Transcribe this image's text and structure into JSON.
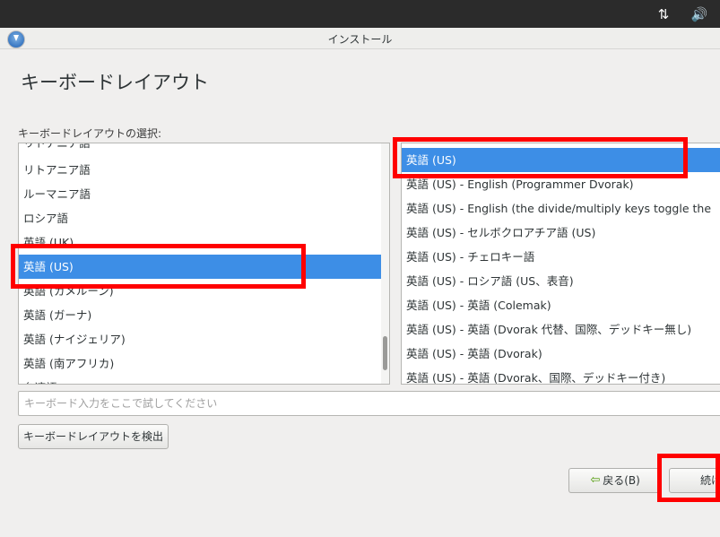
{
  "system_panel": {
    "network_icon": "updown-arrows-icon",
    "volume_icon": "speaker-icon"
  },
  "window": {
    "title": "インストール"
  },
  "page": {
    "title": "キーボードレイアウト",
    "select_label": "キーボードレイアウトの選択:"
  },
  "layouts": [
    {
      "label": "リトアニア語"
    },
    {
      "label": "リトアニア語"
    },
    {
      "label": "ルーマニア語"
    },
    {
      "label": "ロシア語"
    },
    {
      "label": "英語 (UK)"
    },
    {
      "label": "英語 (US)",
      "selected": true
    },
    {
      "label": "英語 (カメルーン)"
    },
    {
      "label": "英語 (ガーナ)"
    },
    {
      "label": "英語 (ナイジェリア)"
    },
    {
      "label": "英語 (南アフリカ)"
    },
    {
      "label": "台湾語"
    }
  ],
  "variants": [
    {
      "label": "英語 (US)",
      "selected": true
    },
    {
      "label": "英語 (US) - English (Programmer Dvorak)"
    },
    {
      "label": "英語 (US) - English (the divide/multiply keys toggle the"
    },
    {
      "label": "英語 (US) - セルボクロアチア語 (US)"
    },
    {
      "label": "英語 (US) - チェロキー語"
    },
    {
      "label": "英語 (US) - ロシア語 (US、表音)"
    },
    {
      "label": "英語 (US) - 英語 (Colemak)"
    },
    {
      "label": "英語 (US) - 英語 (Dvorak 代替、国際、デッドキー無し)"
    },
    {
      "label": "英語 (US) - 英語 (Dvorak)"
    },
    {
      "label": "英語 (US) - 英語 (Dvorak、国際、デッドキー付き)"
    }
  ],
  "test_input": {
    "value": "",
    "placeholder": "キーボード入力をここで試してください"
  },
  "buttons": {
    "detect": "キーボードレイアウトを検出",
    "back": "戻る(B)",
    "continue": "続け"
  },
  "colors": {
    "selection": "#3d8ee6",
    "annotation": "#ff0000"
  }
}
